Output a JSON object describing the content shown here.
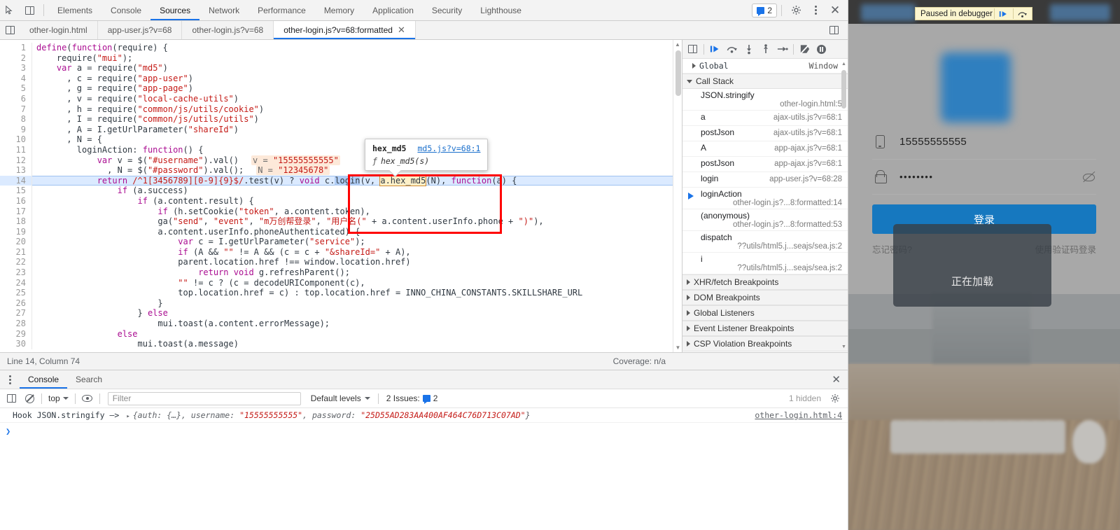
{
  "devtools": {
    "main_tabs": [
      {
        "label": "Elements",
        "active": false
      },
      {
        "label": "Console",
        "active": false
      },
      {
        "label": "Sources",
        "active": true
      },
      {
        "label": "Network",
        "active": false
      },
      {
        "label": "Performance",
        "active": false
      },
      {
        "label": "Memory",
        "active": false
      },
      {
        "label": "Application",
        "active": false
      },
      {
        "label": "Security",
        "active": false
      },
      {
        "label": "Lighthouse",
        "active": false
      }
    ],
    "inspect_icon": "inspect-cursor-icon",
    "device_icon": "device-toolbar-icon",
    "issues_count": "2",
    "settings_icon": "gear-icon",
    "more_icon": "kebab-menu-icon",
    "close_icon": "close-icon"
  },
  "file_tabs": [
    {
      "label": "other-login.html",
      "active": false,
      "closable": false
    },
    {
      "label": "app-user.js?v=68",
      "active": false,
      "closable": false
    },
    {
      "label": "other-login.js?v=68",
      "active": false,
      "closable": false
    },
    {
      "label": "other-login.js?v=68:formatted",
      "active": true,
      "closable": true,
      "close_glyph": "✕"
    }
  ],
  "editor": {
    "lines": [
      {
        "n": 1,
        "text": "define(function(require) {"
      },
      {
        "n": 2,
        "text": "    require(\"mui\");"
      },
      {
        "n": 3,
        "text": "    var a = require(\"md5\")"
      },
      {
        "n": 4,
        "text": "      , c = require(\"app-user\")"
      },
      {
        "n": 5,
        "text": "      , g = require(\"app-page\")"
      },
      {
        "n": 6,
        "text": "      , v = require(\"local-cache-utils\")"
      },
      {
        "n": 7,
        "text": "      , h = require(\"common/js/utils/cookie\")"
      },
      {
        "n": 8,
        "text": "      , I = require(\"common/js/utils/utils\")"
      },
      {
        "n": 9,
        "text": "      , A = I.getUrlParameter(\"shareId\")"
      },
      {
        "n": 10,
        "text": "      , N = {"
      },
      {
        "n": 11,
        "text": "        loginAction: function() {"
      },
      {
        "n": 12,
        "text": "            var v = $(\"#username\").val()",
        "inline_value": "v = \"15555555555\""
      },
      {
        "n": 13,
        "text": "              , N = $(\"#password\").val();",
        "inline_value": "N = \"12345678\""
      },
      {
        "n": 14,
        "text": "            return /^1[3456789][0-9]{9}$/.test(v) ? void c.login(v, a.hex_md5(N), function(a) {",
        "current": true
      },
      {
        "n": 15,
        "text": "                if (a.success)"
      },
      {
        "n": 16,
        "text": "                    if (a.content.result) {"
      },
      {
        "n": 17,
        "text": "                        if (h.setCookie(\"token\", a.content.token),"
      },
      {
        "n": 18,
        "text": "                        ga(\"send\", \"event\", \"m万创帮登录\", \"用户名(\" + a.content.userInfo.phone + \")\"),"
      },
      {
        "n": 19,
        "text": "                        a.content.userInfo.phoneAuthenticated) {"
      },
      {
        "n": 20,
        "text": "                            var c = I.getUrlParameter(\"service\");"
      },
      {
        "n": 21,
        "text": "                            if (A && \"\" != A && (c = c + \"&shareId=\" + A),"
      },
      {
        "n": 22,
        "text": "                            parent.location.href !== window.location.href)"
      },
      {
        "n": 23,
        "text": "                                return void g.refreshParent();"
      },
      {
        "n": 24,
        "text": "                            \"\" != c ? (c = decodeURIComponent(c),"
      },
      {
        "n": 25,
        "text": "                            top.location.href = c) : top.location.href = INNO_CHINA_CONSTANTS.SKILLSHARE_URL"
      },
      {
        "n": 26,
        "text": "                        }"
      },
      {
        "n": 27,
        "text": "                    } else"
      },
      {
        "n": 28,
        "text": "                        mui.toast(a.content.errorMessage);"
      },
      {
        "n": 29,
        "text": "                else"
      },
      {
        "n": 30,
        "text": "                    mui.toast(a.message)"
      }
    ],
    "selection_text": "login",
    "highlight_token": "a.hex_md5"
  },
  "tooltip": {
    "name": "hex_md5",
    "link": "md5.js?v=68:1",
    "signature": "hex_md5(s)",
    "f_glyph": "ƒ"
  },
  "debugger": {
    "toolbar": [
      {
        "name": "resume-script-button",
        "glyph": "resume"
      },
      {
        "name": "step-over-button",
        "glyph": "step-over"
      },
      {
        "name": "step-into-button",
        "glyph": "step-into"
      },
      {
        "name": "step-out-button",
        "glyph": "step-out"
      },
      {
        "name": "step-button",
        "glyph": "step"
      },
      {
        "name": "deactivate-breakpoints-button",
        "glyph": "deactivate"
      },
      {
        "name": "pause-on-exceptions-button",
        "glyph": "pause-exceptions"
      }
    ],
    "scope_row": {
      "label": "Global",
      "value": "Window"
    },
    "call_stack_header": "Call Stack",
    "call_stack": [
      {
        "fn": "JSON.stringify",
        "loc": "other-login.html:5",
        "wrap": true,
        "selected": false
      },
      {
        "fn": "a",
        "loc": "ajax-utils.js?v=68:1",
        "wrap": false,
        "selected": false
      },
      {
        "fn": "postJson",
        "loc": "ajax-utils.js?v=68:1",
        "wrap": false,
        "selected": false
      },
      {
        "fn": "A",
        "loc": "app-ajax.js?v=68:1",
        "wrap": false,
        "selected": false
      },
      {
        "fn": "postJson",
        "loc": "app-ajax.js?v=68:1",
        "wrap": false,
        "selected": false
      },
      {
        "fn": "login",
        "loc": "app-user.js?v=68:28",
        "wrap": false,
        "selected": false
      },
      {
        "fn": "loginAction",
        "loc": "other-login.js?...8:formatted:14",
        "wrap": true,
        "selected": true
      },
      {
        "fn": "(anonymous)",
        "loc": "other-login.js?...8:formatted:53",
        "wrap": true,
        "selected": false
      },
      {
        "fn": "dispatch",
        "loc": "??utils/html5.j...seajs/sea.js:2",
        "wrap": true,
        "selected": false
      },
      {
        "fn": "i",
        "loc": "??utils/html5.j...seajs/sea.js:2",
        "wrap": true,
        "selected": false
      }
    ],
    "sections": [
      "XHR/fetch Breakpoints",
      "DOM Breakpoints",
      "Global Listeners",
      "Event Listener Breakpoints",
      "CSP Violation Breakpoints"
    ]
  },
  "status_bar": {
    "cursor": "Line 14, Column 74",
    "coverage": "Coverage: n/a"
  },
  "drawer": {
    "tabs": [
      {
        "label": "Console",
        "active": true
      },
      {
        "label": "Search",
        "active": false
      }
    ],
    "close_glyph": "✕",
    "more_icon": "kebab-menu-icon"
  },
  "console_toolbar": {
    "context": "top",
    "levels": "Default levels",
    "filter_placeholder": "Filter",
    "filter_value": "",
    "issues_label": "2 Issues:",
    "issues_count": "2",
    "hidden_label": "1 hidden",
    "settings_icon": "gear-icon",
    "sidebar_icon": "console-sidebar-icon",
    "clear_icon": "clear-console-icon",
    "eye_icon": "live-expression-icon"
  },
  "console_messages": [
    {
      "prefix": "Hook JSON.stringify —>",
      "arrow": "▸",
      "preview_open": "{auth: {…}, username: ",
      "username": "\"15555555555\"",
      "preview_mid": ", password: ",
      "password": "\"25D55AD283AA400AF464C76D713C07AD\"",
      "preview_close": "}",
      "link": "other-login.html:4"
    }
  ],
  "console_prompt": {
    "caret": "❯",
    "value": ""
  },
  "browser_page": {
    "paused_banner": {
      "text": "Paused in debugger",
      "resume_icon": "resume-icon",
      "step-over_icon": "step-over-icon"
    },
    "phone_value": "15555555555",
    "password_dots": "••••••••",
    "phone_icon": "phone-icon",
    "lock_icon": "lock-icon",
    "eye_off_icon": "eye-off-icon",
    "login_button": "登录",
    "forgot_password": "忘记密码?",
    "sms_login": "使用验证码登录",
    "loading_text": "正在加载"
  },
  "colors": {
    "accent": "#1a73e8",
    "annotation": "#ff0000",
    "login_button": "#1678bf",
    "inline_value_bg": "#fde9d9",
    "tooltip_link": "#1a6fcc"
  }
}
